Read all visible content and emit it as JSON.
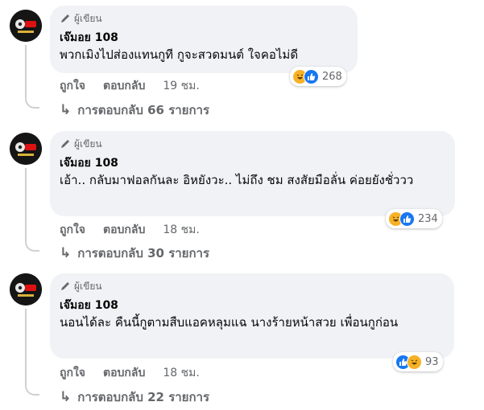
{
  "comments": [
    {
      "badge": "ผู้เขียน",
      "author": "เจ๊มอย 108",
      "text": "พวกเมิงไปส่องแทนกูที กูจะสวดมนต์ ใจคอไม่ดี",
      "reaction_count": "268",
      "reactions": [
        "haha-icon",
        "like-icon"
      ],
      "like_label": "ถูกใจ",
      "reply_label": "ตอบกลับ",
      "time": "19 ชม.",
      "replies": "การตอบกลับ 66 รายการ"
    },
    {
      "badge": "ผู้เขียน",
      "author": "เจ๊มอย 108",
      "text": "เอ้า.. กลับมาฟอลกันละ อิหยังวะ.. ไม่ถึง ชม สงสัยมือลั่น ค่อยยังชั่ววว",
      "reaction_count": "234",
      "reactions": [
        "haha-icon",
        "like-icon"
      ],
      "like_label": "ถูกใจ",
      "reply_label": "ตอบกลับ",
      "time": "18 ชม.",
      "replies": "การตอบกลับ 30 รายการ"
    },
    {
      "badge": "ผู้เขียน",
      "author": "เจ๊มอย 108",
      "text": "นอนได้ละ คืนนี้กูตามสืบแอคหลุมแฉ นางร้ายหน้าสวย เพื่อนกูก่อน",
      "reaction_count": "93",
      "reactions": [
        "like-icon",
        "haha-icon"
      ],
      "like_label": "ถูกใจ",
      "reply_label": "ตอบกลับ",
      "time": "18 ชม.",
      "replies": "การตอบกลับ 22 รายการ"
    }
  ],
  "colors": {
    "bubble": "#f0f2f5",
    "secondary_text": "#65676b",
    "like_blue": "#1877f2",
    "haha_yellow": "#f7b125"
  }
}
